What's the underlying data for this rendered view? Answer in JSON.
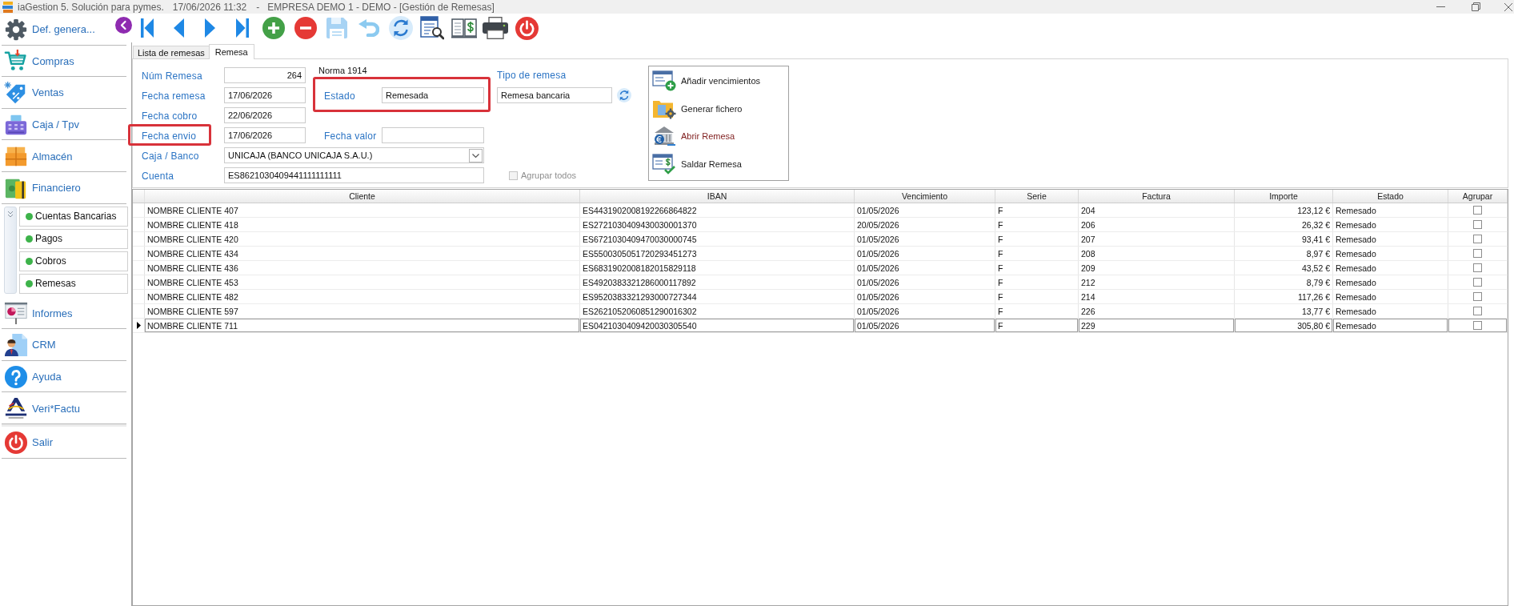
{
  "title_bar": {
    "app_title": "iaGestion 5. Solución para pymes.",
    "datetime": "17/06/2026 11:32",
    "separator": "-",
    "context": "EMPRESA DEMO 1 - DEMO - [Gestión de Remesas]"
  },
  "sidebar": {
    "items": [
      {
        "label": "Def. genera..."
      },
      {
        "label": "Compras"
      },
      {
        "label": "Ventas"
      },
      {
        "label": "Caja / Tpv"
      },
      {
        "label": "Almacén"
      },
      {
        "label": "Financiero",
        "expanded": true,
        "children": [
          {
            "label": "Cuentas Bancarias"
          },
          {
            "label": "Pagos"
          },
          {
            "label": "Cobros"
          },
          {
            "label": "Remesas"
          }
        ]
      },
      {
        "label": "Informes"
      },
      {
        "label": "CRM"
      },
      {
        "label": "Ayuda"
      },
      {
        "label": "Veri*Factu"
      },
      {
        "label": "Salir"
      }
    ]
  },
  "tabs": [
    {
      "label": "Lista de remesas",
      "selected": false
    },
    {
      "label": "Remesa",
      "selected": true
    }
  ],
  "form": {
    "num_remesa": {
      "label": "Núm Remesa",
      "value": "264"
    },
    "norma": "Norma 1914",
    "tipo_remesa": {
      "label": "Tipo de remesa",
      "value": "Remesa bancaria"
    },
    "fecha_remesa": {
      "label": "Fecha remesa",
      "value": "17/06/2026"
    },
    "estado": {
      "label": "Estado",
      "value": "Remesada",
      "highlighted": true
    },
    "fecha_cobro": {
      "label": "Fecha cobro",
      "value": "22/06/2026"
    },
    "fecha_envio": {
      "label": "Fecha envio",
      "value": "17/06/2026",
      "highlighted": true
    },
    "fecha_valor": {
      "label": "Fecha valor"
    },
    "caja_banco": {
      "label": "Caja / Banco",
      "value": "UNICAJA (BANCO UNICAJA S.A.U.)"
    },
    "cuenta": {
      "label": "Cuenta",
      "value": "ES8621030409441111111111"
    },
    "agrupar_todos": {
      "label": "Agrupar todos",
      "checked": false,
      "disabled": true
    }
  },
  "actions": [
    {
      "label": "Añadir vencimientos",
      "color": "#1a1a1a"
    },
    {
      "label": "Generar fichero",
      "color": "#1a1a1a"
    },
    {
      "label": "Abrir Remesa",
      "color": "#7f1d1d"
    },
    {
      "label": "Saldar Remesa",
      "color": "#1a1a1a"
    }
  ],
  "table": {
    "columns": [
      "Cliente",
      "IBAN",
      "Vencimiento",
      "Serie",
      "Factura",
      "Importe",
      "Estado",
      "Agrupar"
    ],
    "rows": [
      {
        "cells": [
          "NOMBRE CLIENTE 407",
          "ES4431902008192266864822",
          "01/05/2026",
          "F",
          "204",
          "123,12 €",
          "Remesado"
        ],
        "checked": false,
        "selected": false
      },
      {
        "cells": [
          "NOMBRE CLIENTE 418",
          "ES2721030409430030001370",
          "20/05/2026",
          "F",
          "206",
          "26,32 €",
          "Remesado"
        ],
        "checked": false,
        "selected": false
      },
      {
        "cells": [
          "NOMBRE CLIENTE 420",
          "ES6721030409470030000745",
          "01/05/2026",
          "F",
          "207",
          "93,41 €",
          "Remesado"
        ],
        "checked": false,
        "selected": false
      },
      {
        "cells": [
          "NOMBRE CLIENTE 434",
          "ES5500305051720293451273",
          "01/05/2026",
          "F",
          "208",
          "8,97 €",
          "Remesado"
        ],
        "checked": false,
        "selected": false
      },
      {
        "cells": [
          "NOMBRE CLIENTE 436",
          "ES6831902008182015829118",
          "01/05/2026",
          "F",
          "209",
          "43,52 €",
          "Remesado"
        ],
        "checked": false,
        "selected": false
      },
      {
        "cells": [
          "NOMBRE CLIENTE 453",
          "ES4920383321286000117892",
          "01/05/2026",
          "F",
          "212",
          "8,79 €",
          "Remesado"
        ],
        "checked": false,
        "selected": false
      },
      {
        "cells": [
          "NOMBRE CLIENTE 482",
          "ES9520383321293000727344",
          "01/05/2026",
          "F",
          "214",
          "117,26 €",
          "Remesado"
        ],
        "checked": false,
        "selected": false
      },
      {
        "cells": [
          "NOMBRE CLIENTE 597",
          "ES2621052060851290016302",
          "01/05/2026",
          "F",
          "226",
          "13,77 €",
          "Remesado"
        ],
        "checked": false,
        "selected": false
      },
      {
        "cells": [
          "NOMBRE CLIENTE 711",
          "ES0421030409420030305540",
          "01/05/2026",
          "F",
          "229",
          "305,80 €",
          "Remesado"
        ],
        "checked": false,
        "selected": true
      }
    ]
  }
}
